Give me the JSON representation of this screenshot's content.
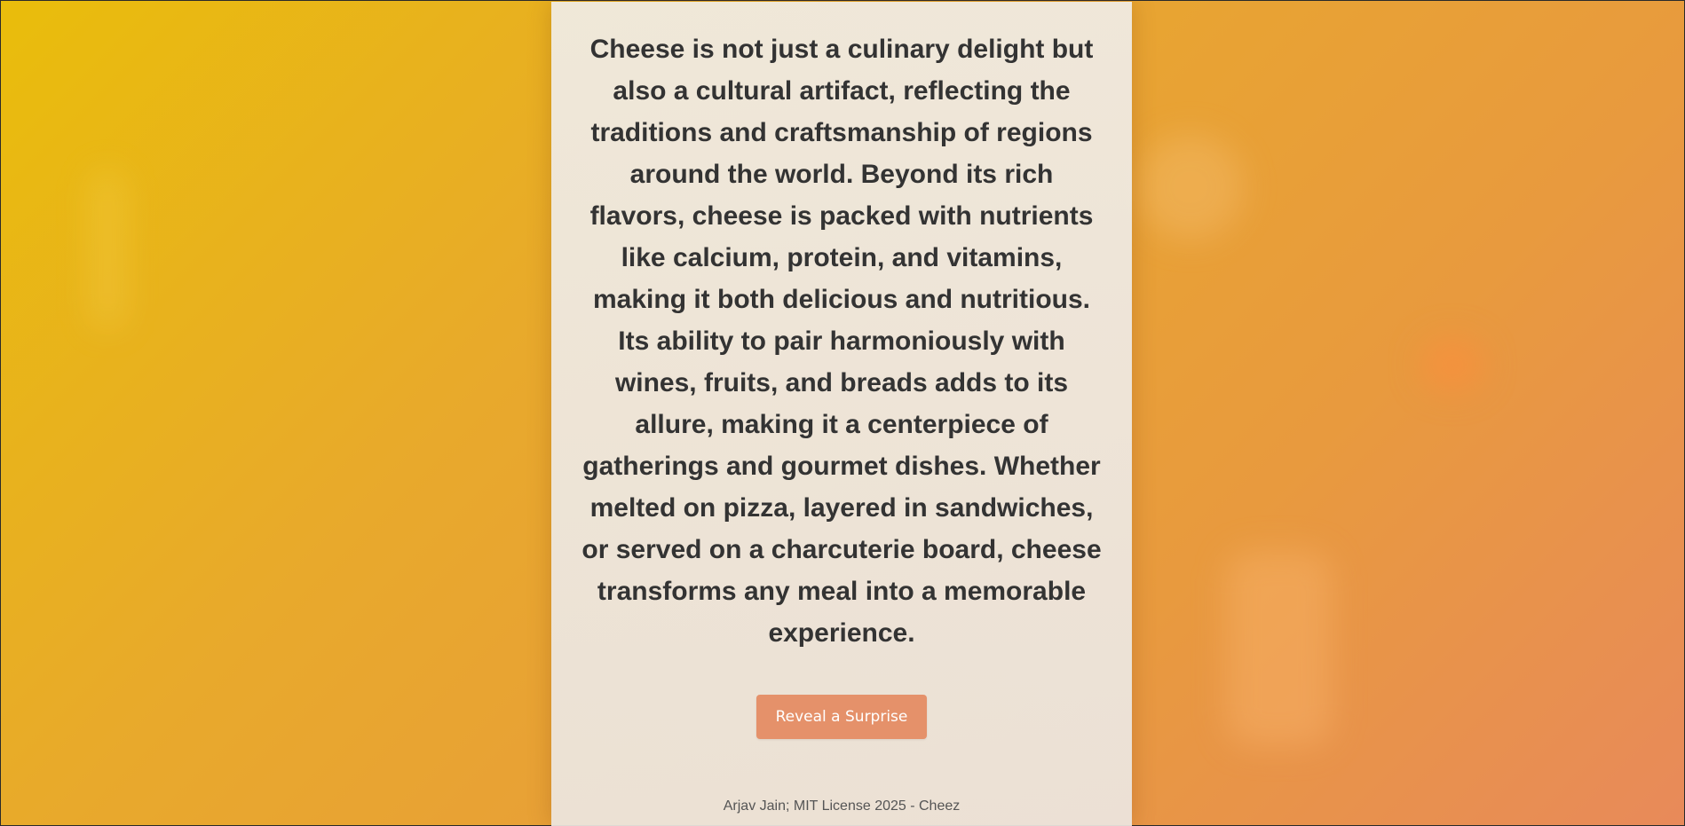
{
  "article": {
    "text": "Cheese is not just a culinary delight but also a cultural artifact, reflecting the traditions and craftsmanship of regions around the world. Beyond its rich flavors, cheese is packed with nutrients like calcium, protein, and vitamins, making it both delicious and nutritious. Its ability to pair harmoniously with wines, fruits, and breads adds to its allure, making it a centerpiece of gatherings and gourmet dishes. Whether melted on pizza, layered in sandwiches, or served on a charcuterie board, cheese transforms any meal into a memorable experience."
  },
  "actions": {
    "surprise_label": "Reveal a Surprise"
  },
  "footer": {
    "text": "Arjav Jain; MIT License 2025 - Cheez"
  },
  "colors": {
    "background_start": "#e9bd0b",
    "background_end": "#e88a5a",
    "panel": "#ece6e0",
    "button": "#e5916a",
    "text": "#333333"
  }
}
